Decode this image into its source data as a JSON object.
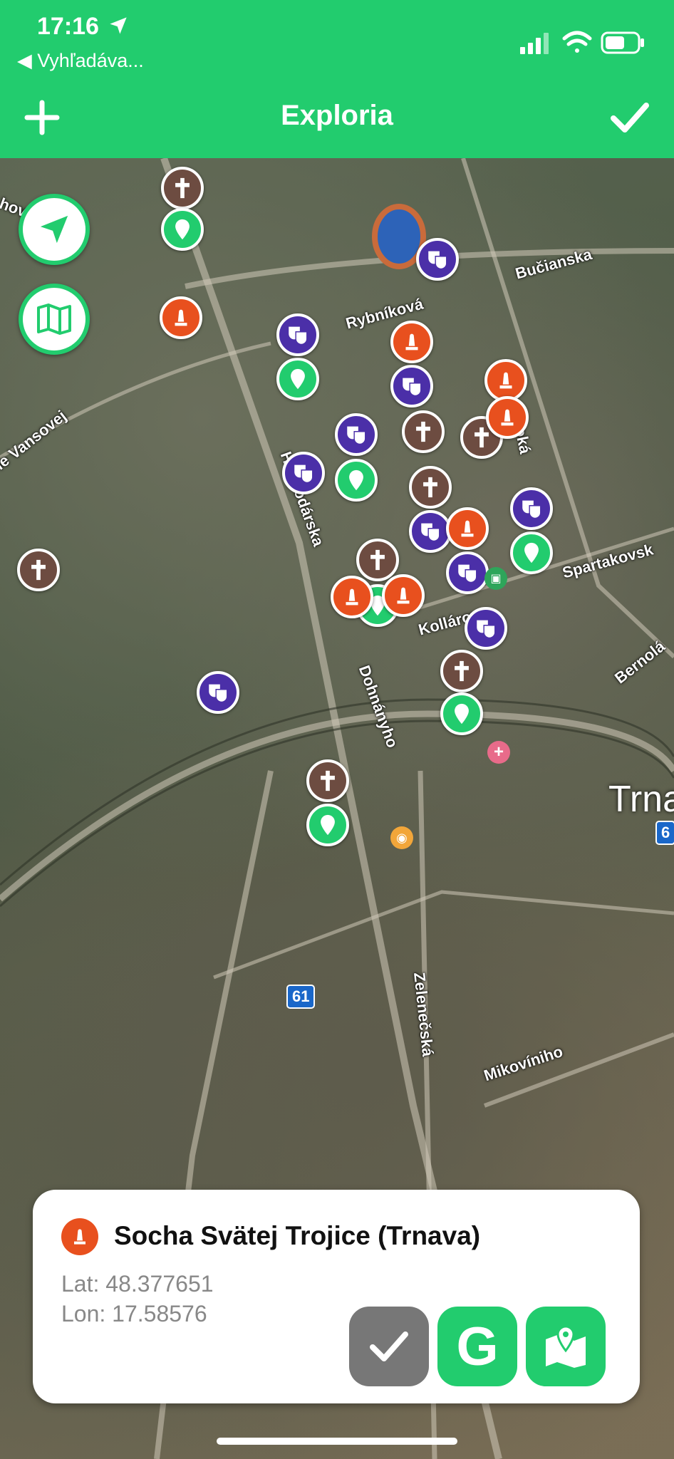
{
  "status_bar": {
    "time": "17:16",
    "back_label": "◀ Vyhľadáva..."
  },
  "nav": {
    "title": "Exploria",
    "add_icon": "plus-icon",
    "done_icon": "checkmark-icon"
  },
  "map": {
    "streets": [
      {
        "name": "Bučianska"
      },
      {
        "name": "Rybníková"
      },
      {
        "name": "Hlboká"
      },
      {
        "name": "Vansovej",
        "display": "ie Vansovej"
      },
      {
        "name": "Hospodárska",
        "display": "Hospodárska"
      },
      {
        "name": "Spartakovská",
        "display": "Spartakovsk"
      },
      {
        "name": "Kollárova"
      },
      {
        "name": "Dohnányho"
      },
      {
        "name": "Bernolákov",
        "display": "Bernolá"
      },
      {
        "name": "Zelenečská"
      },
      {
        "name": "Mikovíniho"
      },
      {
        "name": "hov",
        "display": "hov"
      }
    ],
    "city_label": "Trna",
    "route_61": "61",
    "route_6": "6",
    "pin_types": {
      "brown": "church-cross-icon",
      "purple": "theater-masks-icon",
      "green": "location-pin-icon",
      "orange": "monument-statue-icon"
    }
  },
  "card": {
    "title": "Socha Svätej Trojice (Trnava)",
    "lat": "Lat: 48.377651",
    "lon": "Lon: 17.58576",
    "icon": "monument-statue-icon"
  },
  "colors": {
    "accent": "#22cc6e",
    "monument": "#e8501e",
    "church": "#6d4c41",
    "theater": "#4b2fa8",
    "gray_button": "#777777"
  }
}
